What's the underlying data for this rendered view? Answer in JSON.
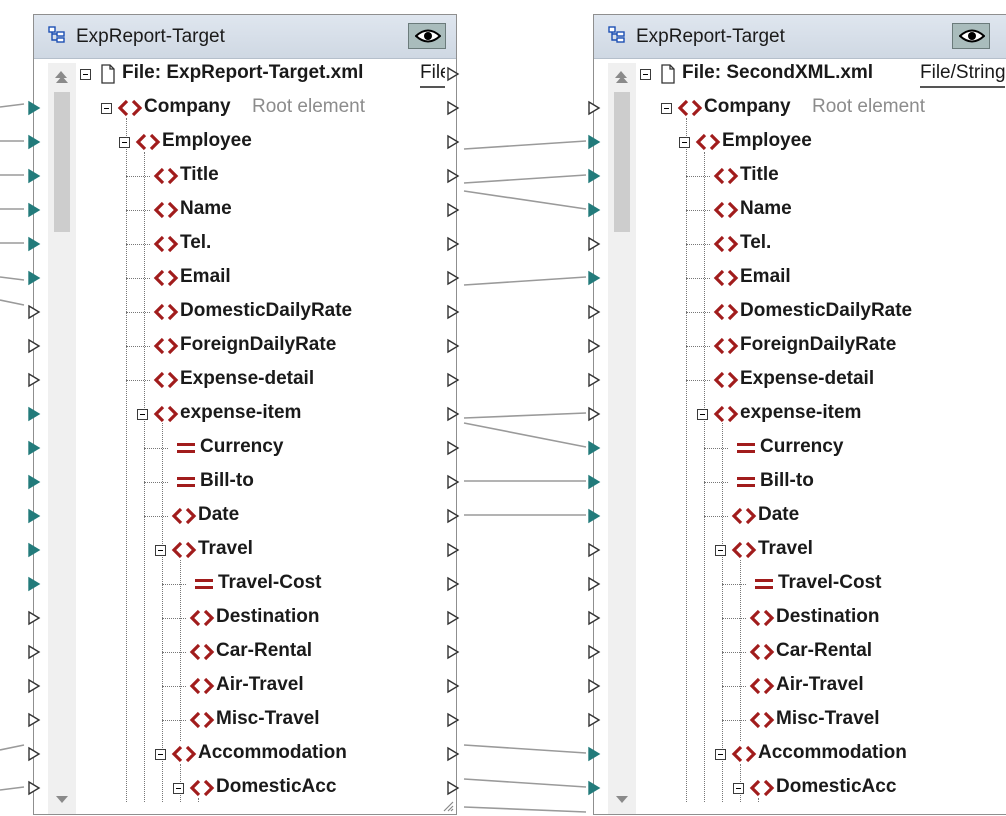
{
  "colors": {
    "element_icon": "#a11c1c",
    "attribute_icon": "#a11c1c",
    "connector_filled": "#237b7b",
    "title_bg": "#d6dee8",
    "eye_button_bg": "#a9bcbc"
  },
  "panels": [
    {
      "title": "ExpReport-Target",
      "file_label": "File: ExpReport-Target.xml",
      "file_action": "File",
      "root_hint": "Root element"
    },
    {
      "title": "ExpReport-Target",
      "file_label": "File: SecondXML.xml",
      "file_action": "File/String",
      "root_hint": "Root element"
    }
  ],
  "tree_items": [
    {
      "label": "Company",
      "kind": "element"
    },
    {
      "label": "Employee",
      "kind": "element"
    },
    {
      "label": "Title",
      "kind": "element"
    },
    {
      "label": "Name",
      "kind": "element"
    },
    {
      "label": "Tel.",
      "kind": "element"
    },
    {
      "label": "Email",
      "kind": "element"
    },
    {
      "label": "DomesticDailyRate",
      "kind": "element"
    },
    {
      "label": "ForeignDailyRate",
      "kind": "element"
    },
    {
      "label": "Expense-detail",
      "kind": "element"
    },
    {
      "label": "expense-item",
      "kind": "element"
    },
    {
      "label": "Currency",
      "kind": "attribute"
    },
    {
      "label": "Bill-to",
      "kind": "attribute"
    },
    {
      "label": "Date",
      "kind": "element"
    },
    {
      "label": "Travel",
      "kind": "element"
    },
    {
      "label": "Travel-Cost",
      "kind": "attribute"
    },
    {
      "label": "Destination",
      "kind": "element"
    },
    {
      "label": "Car-Rental",
      "kind": "element"
    },
    {
      "label": "Air-Travel",
      "kind": "element"
    },
    {
      "label": "Misc-Travel",
      "kind": "element"
    },
    {
      "label": "Accommodation",
      "kind": "element"
    },
    {
      "label": "DomesticAcc",
      "kind": "element"
    }
  ],
  "icons": {
    "title": "component-tree-icon",
    "view": "eye-icon",
    "file": "document-icon",
    "element": "element-brackets-icon",
    "attribute": "attribute-equals-icon",
    "input_connector": "input-connector-icon",
    "output_connector": "output-connector-icon"
  }
}
